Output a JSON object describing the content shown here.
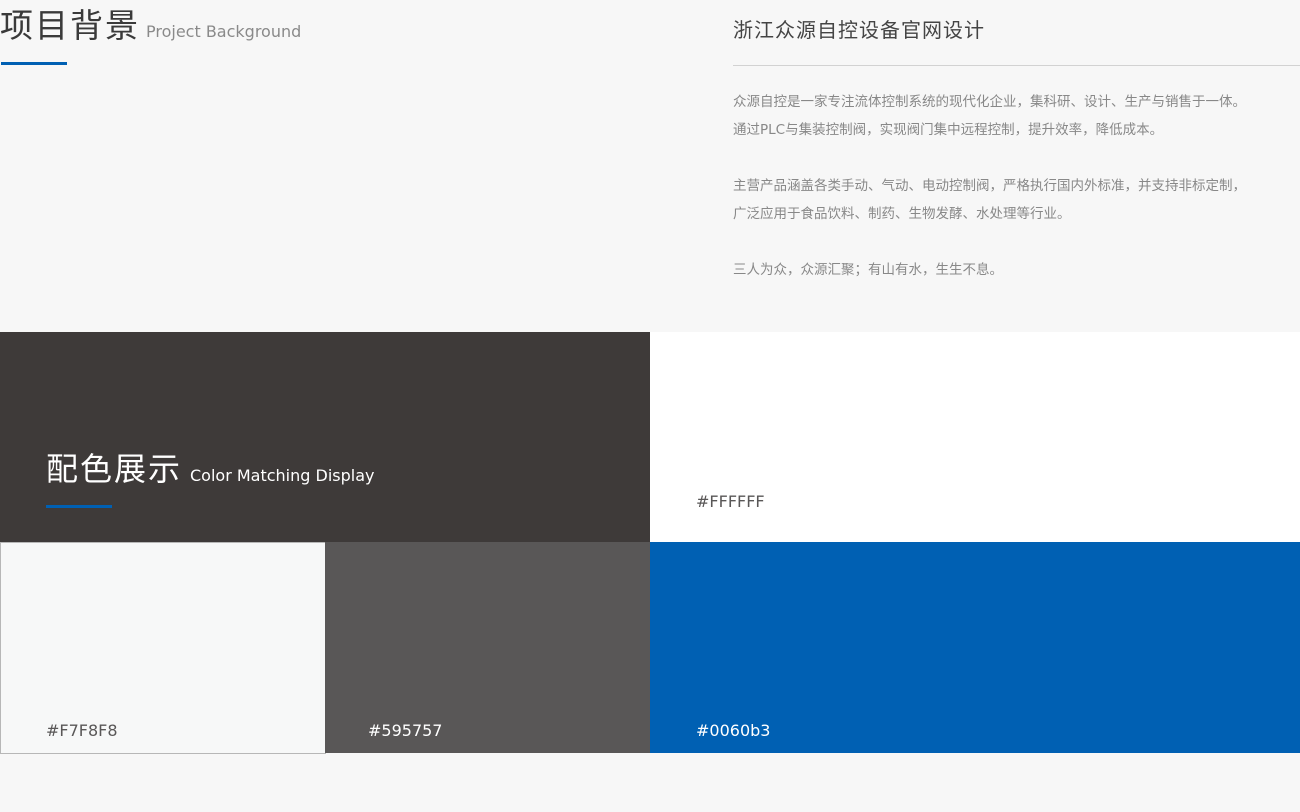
{
  "project_background": {
    "title": "项目背景",
    "subtitle": "Project Background",
    "accent_color": "#0060b3"
  },
  "company": {
    "title": "浙江众源自控设备官网设计",
    "paragraphs": [
      {
        "line1": "众源自控是一家专注流体控制系统的现代化企业，集科研、设计、生产与销售于一体。",
        "line2": "通过PLC与集装控制阀，实现阀门集中远程控制，提升效率，降低成本。"
      },
      {
        "line1": "主营产品涵盖各类手动、气动、电动控制阀，严格执行国内外标准，并支持非标定制，",
        "line2": "广泛应用于食品饮料、制药、生物发酵、水处理等行业。"
      },
      {
        "line1": "三人为众，众源汇聚；有山有水，生生不息。"
      }
    ]
  },
  "color_display": {
    "title": "配色展示",
    "subtitle": "Color Matching Display",
    "header_bg": "#3e3a39",
    "accent_color": "#0060b3",
    "swatches": {
      "white": {
        "label": "#FFFFFF",
        "color": "#FFFFFF"
      },
      "light": {
        "label": "#F7F8F8",
        "color": "#F7F8F8"
      },
      "gray": {
        "label": "#595757",
        "color": "#595757"
      },
      "blue": {
        "label": "#0060b3",
        "color": "#0060b3"
      }
    }
  }
}
